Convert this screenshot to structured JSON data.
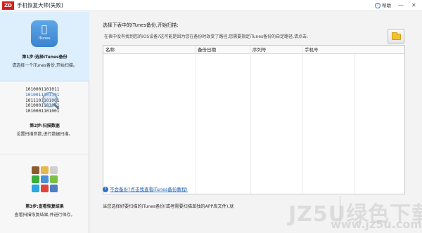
{
  "titlebar": {
    "logo": "ZD",
    "title": "手机恢复大师(失败)",
    "help": "帮助",
    "help_icon": "?",
    "minimize": "—",
    "close": "✕"
  },
  "sidebar": {
    "steps": [
      {
        "title": "第1步:选择iTunes备份",
        "desc": "请选择一个iTunes备份,开始扫描。",
        "icon": "itunes-icon",
        "icon_text": "iTunes"
      },
      {
        "title": "第2步:扫描数据",
        "desc": "设置扫描参数,进行数据扫描。",
        "icon": "binary-magnifier-icon",
        "binary_lines": [
          "1010001101011",
          "1010011101101",
          "1011101101001",
          "1010001101011",
          "1010001101001"
        ]
      },
      {
        "title": "第3步:查看恢复结果",
        "desc": "查看扫描恢复结果,并进行保存。",
        "icon": "apps-icon"
      }
    ]
  },
  "main": {
    "instruction": "选择下表中的iTunes备份,开始扫描:",
    "subinstruction": "在表中没有找到您的iOS设备?这可能是因为您在备份时改变了路径,您需要指定iTunes备份的自定路径,请点击:",
    "table": {
      "columns": [
        "名称",
        "备份日期",
        "序列号",
        "手机号"
      ],
      "rows": []
    },
    "help_link": "不会备份?点击我查看iTunes备份教程!",
    "help_link_icon": "?",
    "bottom_message": "当您选择好要扫描的iTunes备份(或者需要扫描单独的APP库文件),就"
  },
  "watermark": {
    "main": "JZ5U绿色下载",
    "sub": "www.jz5u.com"
  },
  "colors": {
    "accent": "#3a83cf",
    "step_active_bg": "#ddeefc",
    "logo_bg": "#d21e1e",
    "link": "#1a5fb4"
  }
}
